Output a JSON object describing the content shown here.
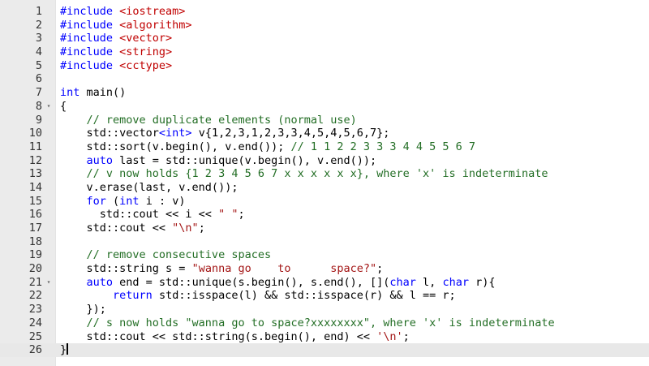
{
  "editor": {
    "active_line": 26,
    "lines": [
      {
        "n": "1",
        "segments": [
          {
            "t": "#include ",
            "c": "kw"
          },
          {
            "t": "<iostream>",
            "c": "incpath"
          }
        ]
      },
      {
        "n": "2",
        "segments": [
          {
            "t": "#include ",
            "c": "kw"
          },
          {
            "t": "<algorithm>",
            "c": "incpath"
          }
        ]
      },
      {
        "n": "3",
        "segments": [
          {
            "t": "#include ",
            "c": "kw"
          },
          {
            "t": "<vector>",
            "c": "incpath"
          }
        ]
      },
      {
        "n": "4",
        "segments": [
          {
            "t": "#include ",
            "c": "kw"
          },
          {
            "t": "<string>",
            "c": "incpath"
          }
        ]
      },
      {
        "n": "5",
        "segments": [
          {
            "t": "#include ",
            "c": "kw"
          },
          {
            "t": "<cctype>",
            "c": "incpath"
          }
        ]
      },
      {
        "n": "6",
        "segments": []
      },
      {
        "n": "7",
        "segments": [
          {
            "t": "int",
            "c": "kw"
          },
          {
            "t": " main()",
            "c": ""
          }
        ]
      },
      {
        "n": "8",
        "fold": true,
        "segments": [
          {
            "t": "{",
            "c": ""
          }
        ]
      },
      {
        "n": "9",
        "segments": [
          {
            "t": "    // remove duplicate elements (normal use)",
            "c": "cmt"
          }
        ]
      },
      {
        "n": "10",
        "segments": [
          {
            "t": "    std::vector",
            "c": ""
          },
          {
            "t": "<int>",
            "c": "kw"
          },
          {
            "t": " v{1,2,3,1,2,3,3,4,5,4,5,6,7};",
            "c": ""
          }
        ]
      },
      {
        "n": "11",
        "segments": [
          {
            "t": "    std::sort(v.begin(), v.end()); ",
            "c": ""
          },
          {
            "t": "// 1 1 2 2 3 3 3 4 4 5 5 6 7",
            "c": "cmt"
          }
        ]
      },
      {
        "n": "12",
        "segments": [
          {
            "t": "    ",
            "c": ""
          },
          {
            "t": "auto",
            "c": "kw"
          },
          {
            "t": " last = std::unique(v.begin(), v.end());",
            "c": ""
          }
        ]
      },
      {
        "n": "13",
        "segments": [
          {
            "t": "    // v now holds {1 2 3 4 5 6 7 x x x x x x}, where 'x' is indeterminate",
            "c": "cmt"
          }
        ]
      },
      {
        "n": "14",
        "segments": [
          {
            "t": "    v.erase(last, v.end());",
            "c": ""
          }
        ]
      },
      {
        "n": "15",
        "segments": [
          {
            "t": "    ",
            "c": ""
          },
          {
            "t": "for",
            "c": "kw"
          },
          {
            "t": " (",
            "c": ""
          },
          {
            "t": "int",
            "c": "kw"
          },
          {
            "t": " i : v)",
            "c": ""
          }
        ]
      },
      {
        "n": "16",
        "segments": [
          {
            "t": "      std::cout << i << ",
            "c": ""
          },
          {
            "t": "\" \"",
            "c": "str"
          },
          {
            "t": ";",
            "c": ""
          }
        ]
      },
      {
        "n": "17",
        "segments": [
          {
            "t": "    std::cout << ",
            "c": ""
          },
          {
            "t": "\"\\n\"",
            "c": "str"
          },
          {
            "t": ";",
            "c": ""
          }
        ]
      },
      {
        "n": "18",
        "segments": []
      },
      {
        "n": "19",
        "segments": [
          {
            "t": "    // remove consecutive spaces",
            "c": "cmt"
          }
        ]
      },
      {
        "n": "20",
        "segments": [
          {
            "t": "    std::string s = ",
            "c": ""
          },
          {
            "t": "\"wanna go    to      space?\"",
            "c": "str"
          },
          {
            "t": ";",
            "c": ""
          }
        ]
      },
      {
        "n": "21",
        "fold": true,
        "segments": [
          {
            "t": "    ",
            "c": ""
          },
          {
            "t": "auto",
            "c": "kw"
          },
          {
            "t": " end = std::unique(s.begin(), s.end(), [](",
            "c": ""
          },
          {
            "t": "char",
            "c": "kw"
          },
          {
            "t": " l, ",
            "c": ""
          },
          {
            "t": "char",
            "c": "kw"
          },
          {
            "t": " r){",
            "c": ""
          }
        ]
      },
      {
        "n": "22",
        "segments": [
          {
            "t": "        ",
            "c": ""
          },
          {
            "t": "return",
            "c": "kw"
          },
          {
            "t": " std::isspace(l) && std::isspace(r) && l == r;",
            "c": ""
          }
        ]
      },
      {
        "n": "23",
        "segments": [
          {
            "t": "    });",
            "c": ""
          }
        ]
      },
      {
        "n": "24",
        "segments": [
          {
            "t": "    // s now holds \"wanna go to space?xxxxxxxx\", where 'x' is indeterminate",
            "c": "cmt"
          }
        ]
      },
      {
        "n": "25",
        "segments": [
          {
            "t": "    std::cout << std::string(s.begin(), end) << ",
            "c": ""
          },
          {
            "t": "'\\n'",
            "c": "str"
          },
          {
            "t": ";",
            "c": ""
          }
        ]
      },
      {
        "n": "26",
        "cursor": true,
        "segments": [
          {
            "t": "}",
            "c": ""
          }
        ]
      }
    ]
  }
}
